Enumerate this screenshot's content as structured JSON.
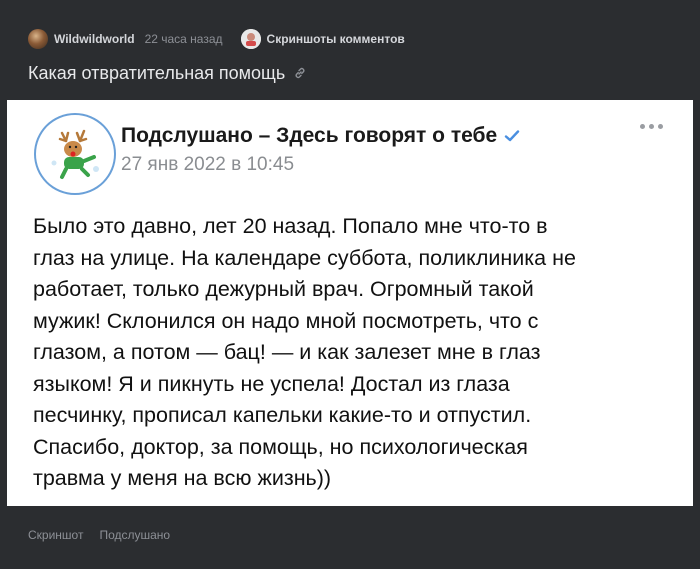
{
  "header": {
    "author": "Wildwildworld",
    "time": "22 часа назад",
    "community": "Скриншоты комментов"
  },
  "story": {
    "title": "Какая отвратительная помощь"
  },
  "post": {
    "group_name": "Подслушано – Здесь говорят о тебе",
    "date": "27 янв 2022 в 10:45",
    "text_lines": [
      "Было это давно, лет 20 назад. Попало мне что-то в",
      "глаз на улице. На календаре суббота, поликлиника не",
      "работает, только дежурный врач. Огромный такой",
      "мужик! Склонился он надо мной посмотреть, что с",
      "глазом, а потом — бац! — и как залезет мне в глаз",
      "языком! Я и пикнуть не успела! Достал из глаза",
      "песчинку, прописал капельки какие-то и отпустил.",
      "Спасибо, доктор, за помощь, но психологическая",
      "травма у меня на всю жизнь))"
    ]
  },
  "tags": [
    "Скриншот",
    "Подслушано"
  ],
  "icons": {
    "link": "link-icon",
    "verified": "verified-check-icon",
    "more": "more-dots-icon"
  },
  "colors": {
    "background": "#2b2d30",
    "card": "#ffffff",
    "verified": "#4a8fe0"
  }
}
